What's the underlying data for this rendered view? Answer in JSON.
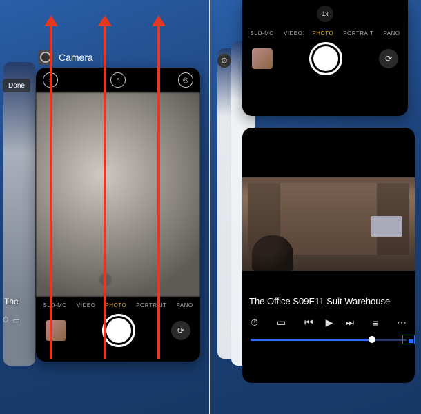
{
  "left": {
    "app_label": "Camera",
    "done_label": "Done",
    "trunc_title": "The",
    "camera": {
      "modes": [
        "SLO-MO",
        "VIDEO",
        "PHOTO",
        "PORTRAIT",
        "PANO"
      ],
      "active_mode_index": 2
    }
  },
  "right": {
    "camera": {
      "zoom": "1x",
      "modes": [
        "SLO-MO",
        "VIDEO",
        "PHOTO",
        "PORTRAIT",
        "PANO"
      ],
      "active_mode_index": 2
    },
    "video": {
      "title": "The Office S09E11 Suit Warehouse",
      "progress_pct": 78
    }
  }
}
